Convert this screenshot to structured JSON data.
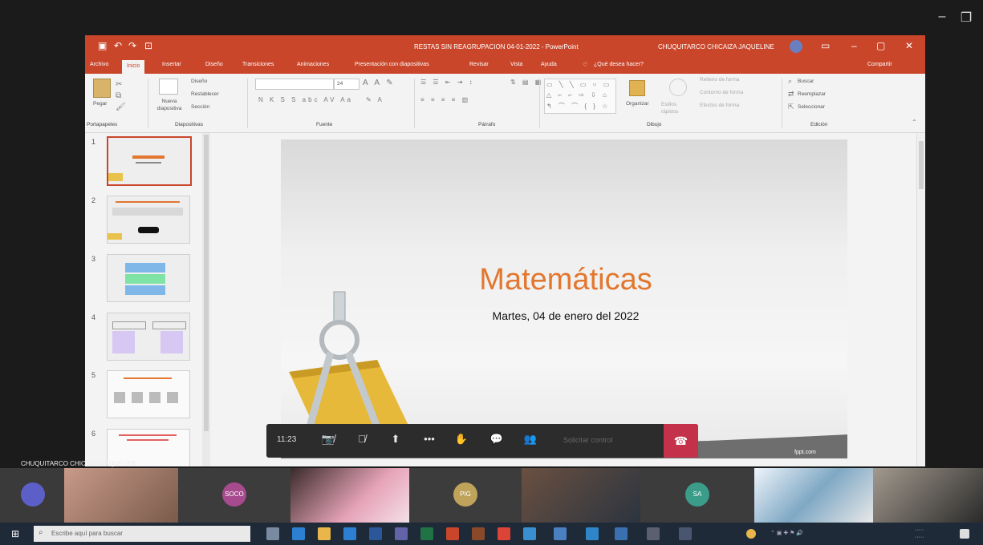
{
  "teams": {
    "window_buttons": {
      "minimize": "–",
      "restore": "❐"
    },
    "presenter_name": "CHUQUITARCO CHICAIZA JAQUELINE",
    "call": {
      "duration": "11:23",
      "request_control": "Solicitar control",
      "icons": [
        "video-off-icon",
        "mic-off-icon",
        "share-tray-icon",
        "more-icon",
        "raise-hand-icon",
        "chat-icon",
        "participants-icon",
        "hangup-icon"
      ]
    },
    "participants": [
      {
        "avatar_bg": "#5b5fc7",
        "initials": ""
      },
      {
        "avatar_bg": "#a74b8f",
        "initials": "SOCO"
      },
      {
        "avatar_bg": "#bfa35a",
        "initials": "PIG"
      },
      {
        "avatar_bg": "#3b9c8a",
        "initials": "SA"
      }
    ]
  },
  "powerpoint": {
    "window_title": "RESTAS SIN REAGRUPACION 04-01-2022 - PowerPoint",
    "user_name": "CHUQUITARCO CHICAIZA JAQUELINE",
    "accent": "#c9462a",
    "tabs": [
      "Archivo",
      "Inicio",
      "Insertar",
      "Diseño",
      "Transiciones",
      "Animaciones",
      "Presentación con diapositivas",
      "Revisar",
      "Vista",
      "Ayuda"
    ],
    "tell_me": "¿Qué desea hacer?",
    "share": "Compartir",
    "ribbon": {
      "clipboard": {
        "paste": "Pegar",
        "label": "Portapapeles"
      },
      "slides": {
        "new_slide": "Nueva diapositiva",
        "layout": "Diseño",
        "reset": "Restablecer",
        "section": "Sección",
        "label": "Diapositivas"
      },
      "font": {
        "label": "Fuente",
        "size": "24"
      },
      "paragraph": {
        "label": "Párrafo"
      },
      "drawing": {
        "arrange": "Organizar",
        "quick_styles": "Estilos rápidos",
        "fill": "Relleno de forma",
        "outline": "Contorno de forma",
        "effects": "Efectos de forma",
        "label": "Dibujo"
      },
      "editing": {
        "find": "Buscar",
        "replace": "Reemplazar",
        "select": "Seleccionar",
        "label": "Edición"
      }
    },
    "thumbnails": [
      "1",
      "2",
      "3",
      "4",
      "5",
      "6"
    ],
    "slide": {
      "title": "Matemáticas",
      "subtitle": "Martes, 04 de enero del 2022",
      "brand": "fppt.com",
      "title_color": "#e2772f"
    }
  },
  "taskbar": {
    "search_placeholder": "Escribe aquí para buscar"
  }
}
